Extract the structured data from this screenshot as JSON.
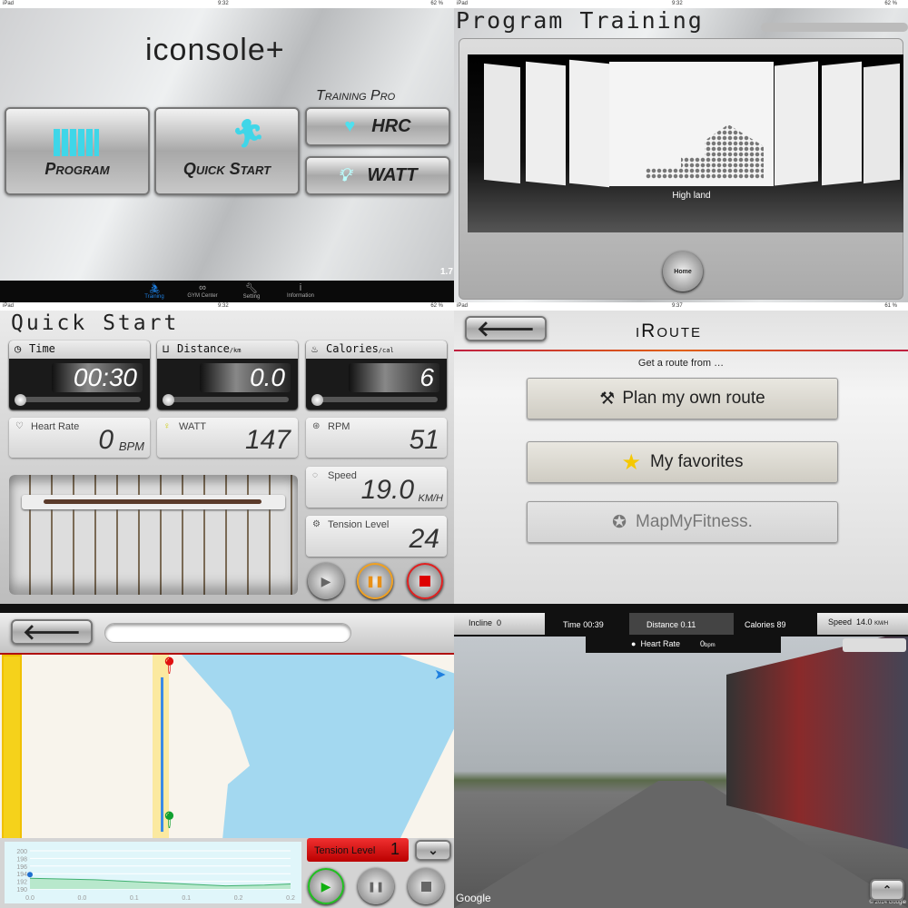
{
  "home": {
    "status": {
      "device": "iPad",
      "time": "9:32",
      "battery": "62 %"
    },
    "logo": "iconsole+",
    "training_pro_label": "Training Pro",
    "buttons": {
      "program": "Program",
      "quick_start": "Quick Start",
      "hrc": "HRC",
      "watt": "WATT"
    },
    "version": "1.7",
    "tabs": [
      {
        "label": "Training",
        "active": true
      },
      {
        "label": "GYM Center"
      },
      {
        "label": "Setting"
      },
      {
        "label": "Information"
      }
    ],
    "accent": "#1e7fe0"
  },
  "program_training": {
    "status": {
      "device": "iPad",
      "time": "9:32",
      "battery": "62 %"
    },
    "title": "Program Training",
    "selected_program": "High land",
    "home_button": "Home"
  },
  "quick_start": {
    "status": {
      "device": "iPad",
      "time": "9:32",
      "battery": "62 %"
    },
    "title": "Quick Start",
    "time": {
      "label": "Time",
      "value": "00:30"
    },
    "distance": {
      "label": "Distance",
      "unit": "/km",
      "value": "0.0"
    },
    "calories": {
      "label": "Calories",
      "unit": "/cal",
      "value": "6"
    },
    "heart_rate": {
      "label": "Heart Rate",
      "value": "0",
      "unit": "BPM"
    },
    "watt": {
      "label": "WATT",
      "value": "147"
    },
    "rpm": {
      "label": "RPM",
      "value": "51"
    },
    "speed": {
      "label": "Speed",
      "value": "19.0",
      "unit": "KM/H"
    },
    "tension": {
      "label": "Tension Level",
      "value": "24"
    }
  },
  "iroute": {
    "status": {
      "device": "iPad",
      "time": "9:37",
      "battery": "61 %"
    },
    "title": "iRoute",
    "subtitle": "Get a route from …",
    "options": [
      "Plan my own route",
      "My favorites",
      "MapMyFitness."
    ]
  },
  "map_view": {
    "search_value": "",
    "tension": {
      "label": "Tension Level",
      "value": "1"
    },
    "colors": {
      "water": "#a3d8f0",
      "land": "#f8f4ec",
      "road": "#f5d21b",
      "route": "#3b8ae6"
    }
  },
  "street_view": {
    "incline": {
      "label": "Incline",
      "value": "0"
    },
    "time": {
      "label": "Time",
      "value": "00:39"
    },
    "distance": {
      "label": "Distance",
      "value": "0.11"
    },
    "calories": {
      "label": "Calories",
      "value": "89"
    },
    "speed": {
      "label": "Speed",
      "value": "14.0",
      "unit": "KM/H"
    },
    "heart_rate": {
      "label": "Heart Rate",
      "value": "0",
      "unit": "bpm"
    },
    "google": "Google",
    "copyright": "© 2014 Google"
  },
  "chart_data": {
    "type": "area",
    "y_ticks": [
      "200",
      "198",
      "196",
      "194",
      "192",
      "190"
    ],
    "x_ticks": [
      "0.0",
      "0.0",
      "0.1",
      "0.1",
      "0.2",
      "0.2"
    ],
    "ylim": [
      190,
      200
    ],
    "x": [
      0,
      0.05,
      0.1,
      0.15,
      0.18,
      0.2
    ],
    "y": [
      192.8,
      192.4,
      191.6,
      190.8,
      191.0,
      191.3
    ],
    "grid": true
  }
}
